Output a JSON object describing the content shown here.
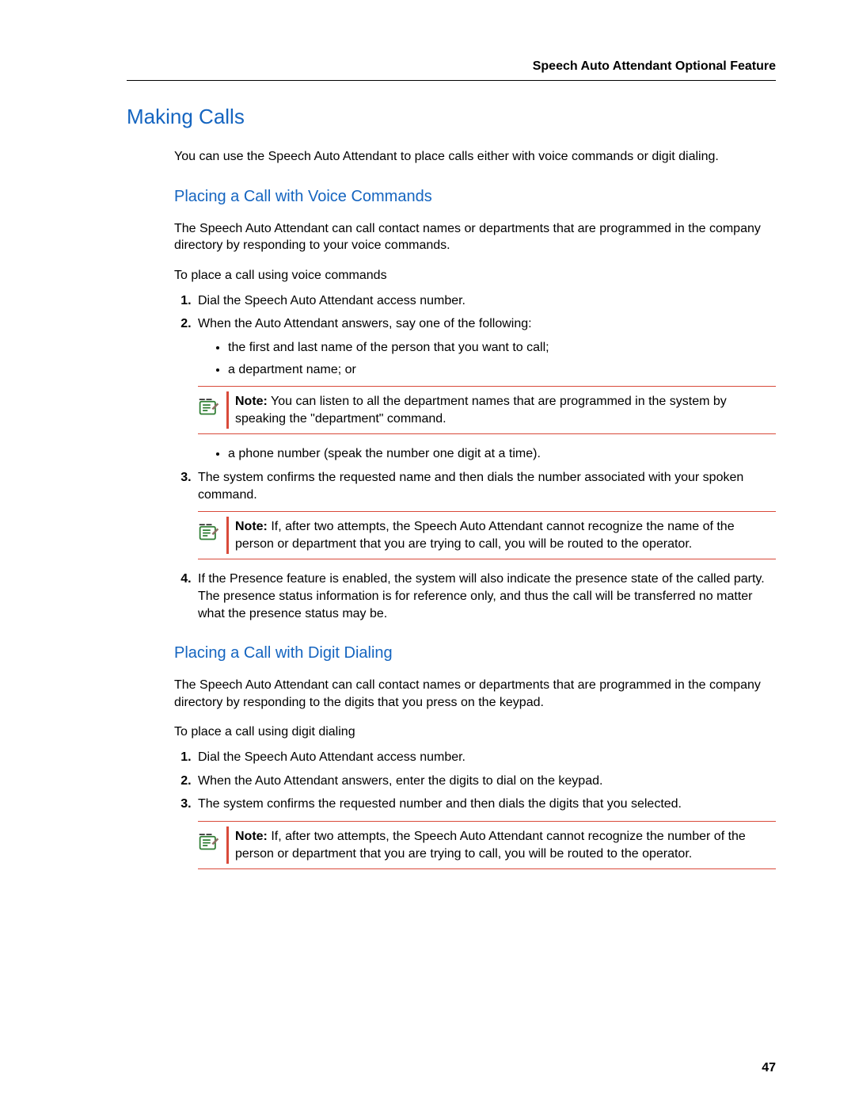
{
  "header": {
    "title": "Speech Auto Attendant Optional Feature"
  },
  "h1": "Making Calls",
  "intro": "You can use the Speech Auto Attendant to place calls either with voice commands or digit dialing.",
  "section_voice": {
    "heading": "Placing a Call with Voice Commands",
    "p1": "The Speech Auto Attendant can call contact names or departments that are programmed in the company directory by responding to your voice commands.",
    "task_intro": "To place a call using voice commands",
    "step1": "Dial the Speech Auto Attendant access number.",
    "step2": "When the Auto Attendant answers, say one of the following:",
    "step2_b1": "the first and last name of the person that you want to call;",
    "step2_b2": "a department name; or",
    "note1_label": "Note:",
    "note1_text": " You can listen to all the department names that are programmed in the system by speaking the \"department\" command.",
    "step2_b3": "a phone number (speak the number one digit at a time).",
    "step3": "The system confirms the requested name and then dials the number associated with your spoken command.",
    "note2_label": "Note:",
    "note2_text": " If, after two attempts, the Speech Auto Attendant cannot recognize the name of the person or department that you are trying to call, you will be routed to the operator.",
    "step4": "If the Presence feature is enabled, the system will also indicate the presence state of the called party. The presence status information is for reference only, and thus the call will be transferred no matter what the presence status may be."
  },
  "section_digit": {
    "heading": "Placing a Call with Digit Dialing",
    "p1": "The Speech Auto Attendant can call contact names or departments that are programmed in the company directory by responding to the digits that you press on the keypad.",
    "task_intro": "To place a call using digit dialing",
    "step1": "Dial the Speech Auto Attendant access number.",
    "step2": "When the Auto Attendant answers, enter the digits to dial on the keypad.",
    "step3": "The system confirms the requested number and then dials the digits that you selected.",
    "note_label": "Note:",
    "note_text": " If, after two attempts, the Speech Auto Attendant cannot recognize the number of the person or department that you are trying to call, you will be routed to the operator."
  },
  "page_number": "47"
}
